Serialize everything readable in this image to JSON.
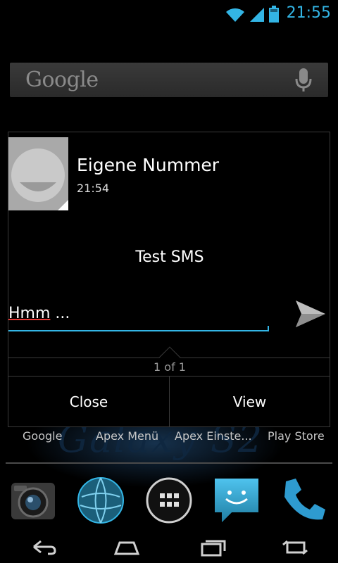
{
  "status_bar": {
    "time": "21:55",
    "accent_color": "#33b5e5",
    "icons": [
      "wifi-icon",
      "signal-icon",
      "battery-icon"
    ]
  },
  "search": {
    "logo": "Google",
    "icon": "mic-icon"
  },
  "notification": {
    "sender": "Eigene Nummer",
    "time": "21:54",
    "message": "Test SMS",
    "reply_text": "Hmm",
    "reply_suffix": " ...",
    "pager": "1 of 1",
    "close_label": "Close",
    "view_label": "View"
  },
  "home": {
    "labels": [
      "Google",
      "Apex Menü",
      "Apex Einste...",
      "Play Store"
    ],
    "wallpaper_text": "Galaxy S2",
    "dock": [
      "camera-icon",
      "browser-globe-icon",
      "app-drawer-icon",
      "messaging-icon",
      "phone-icon"
    ]
  },
  "nav": [
    "back-icon",
    "home-icon",
    "recent-apps-icon",
    "rotate-icon"
  ]
}
